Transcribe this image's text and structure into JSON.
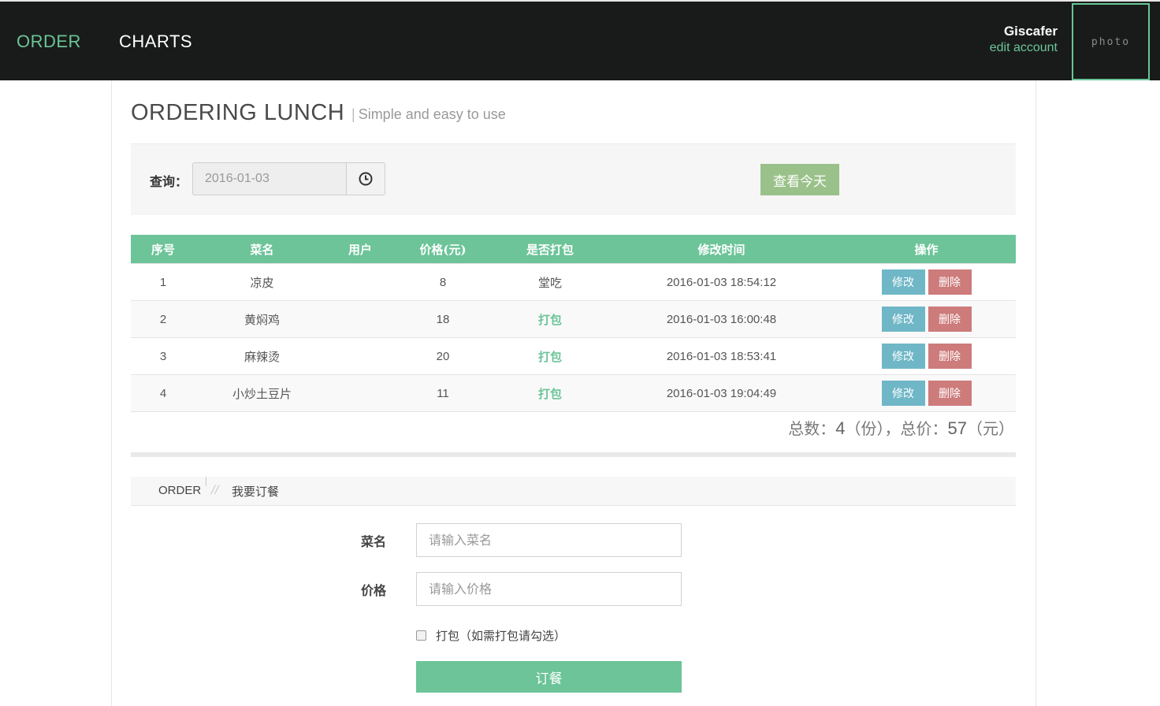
{
  "nav": {
    "order_label": "ORDER",
    "charts_label": "CHARTS"
  },
  "user": {
    "name": "Giscafer",
    "edit_label": "edit account",
    "photo_label": "photo"
  },
  "header": {
    "title": "ORDERING LUNCH",
    "subtitle_bar": "|",
    "subtitle": "Simple and easy to use"
  },
  "query": {
    "label": "查询：",
    "date_value": "2016-01-03",
    "today_button": "查看今天"
  },
  "table": {
    "columns": [
      "序号",
      "菜名",
      "用户",
      "价格(元)",
      "是否打包",
      "修改时间",
      "操作"
    ],
    "rows": [
      {
        "id": "1",
        "dish": "凉皮",
        "user": "",
        "price": "8",
        "pack": "堂吃",
        "time": "2016-01-03 18:54:12"
      },
      {
        "id": "2",
        "dish": "黄焖鸡",
        "user": "",
        "price": "18",
        "pack": "打包",
        "time": "2016-01-03 16:00:48"
      },
      {
        "id": "3",
        "dish": "麻辣烫",
        "user": "",
        "price": "20",
        "pack": "打包",
        "time": "2016-01-03 18:53:41"
      },
      {
        "id": "4",
        "dish": "小炒土豆片",
        "user": "",
        "price": "11",
        "pack": "打包",
        "time": "2016-01-03 19:04:49"
      }
    ],
    "edit_label": "修改",
    "delete_label": "删除"
  },
  "totals": {
    "count_label": "总数：",
    "count": "4",
    "count_unit": "（份）",
    "separator": "，",
    "price_label": "总价：",
    "price": "57",
    "price_unit": "（元）"
  },
  "breadcrumb": {
    "root": "ORDER",
    "sep": "//",
    "current": "我要订餐"
  },
  "form": {
    "dish_label": "菜名",
    "dish_placeholder": "请输入菜名",
    "price_label": "价格",
    "price_placeholder": "请输入价格",
    "pack_label": "打包（如需打包请勾选）",
    "submit_label": "订餐"
  },
  "colors": {
    "accent": "#6cc498",
    "navbar": "#191b1a",
    "edit_button": "#6fb7c7",
    "delete_button": "#cd7b7b",
    "today_button": "#9bc18a"
  }
}
